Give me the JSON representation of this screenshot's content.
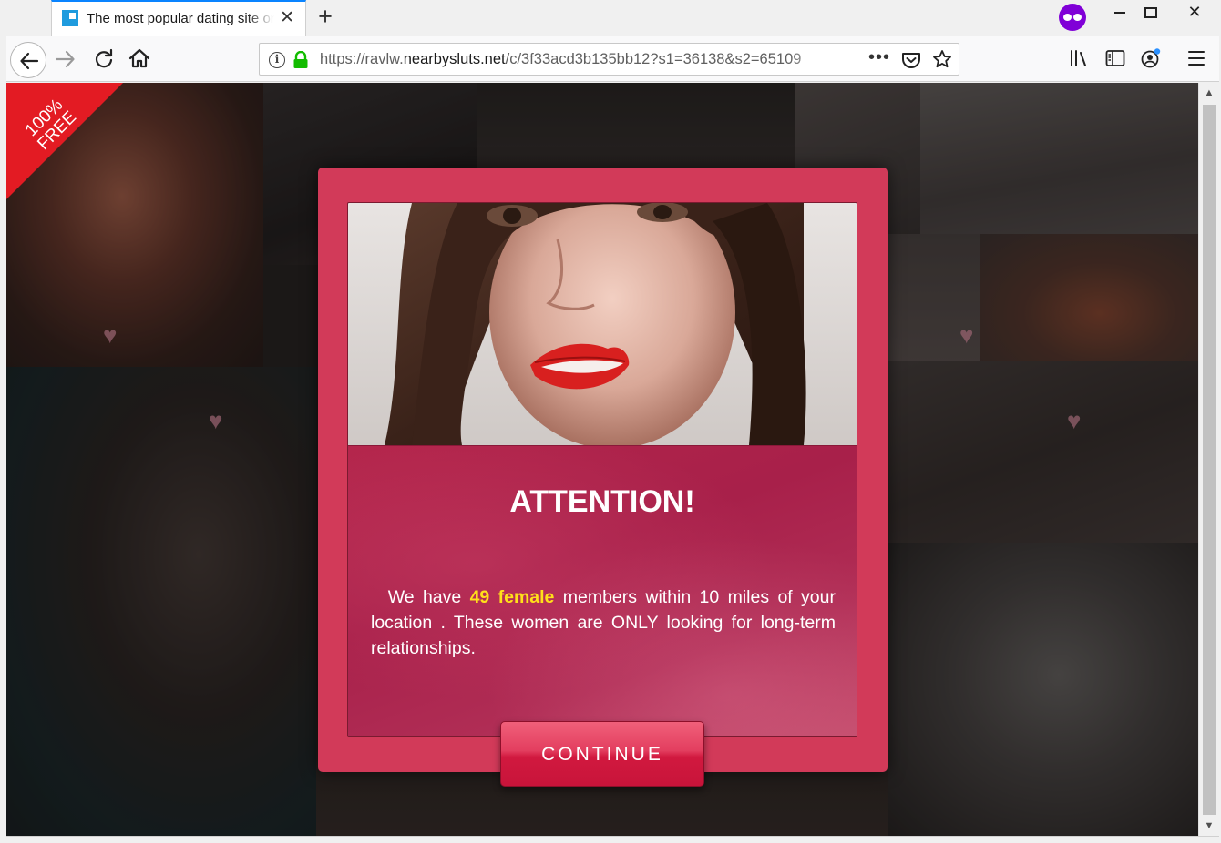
{
  "browser": {
    "tab_title": "The most popular dating site online",
    "tab_close_glyph": "✕",
    "new_tab_glyph": "+",
    "url_scheme": "https://",
    "url_subdomain": "ravlw.",
    "url_host": "nearbysluts.net",
    "url_path": "/c/3f33acd3b135bb12?s1=36138&s2=65109",
    "page_actions_glyph": "•••",
    "info_glyph": "i",
    "window_close_glyph": "✕"
  },
  "page": {
    "ribbon_text": "100% FREE",
    "modal": {
      "title": "ATTENTION!",
      "message_prefix": "We have ",
      "highlight": "49 female",
      "message_suffix": " members within 10 miles of your location . These women are ONLY looking for long-term relationships.",
      "cta": "CONTINUE"
    },
    "heart_glyph": "♥"
  },
  "scrollbar": {
    "up_glyph": "▲",
    "down_glyph": "▼"
  },
  "colors": {
    "modal_frame": "#d23a59",
    "modal_body": "#b2284d",
    "highlight": "#ffe01a",
    "ribbon": "#e31b23",
    "private_badge": "#8000d7",
    "lock": "#12bc00"
  }
}
